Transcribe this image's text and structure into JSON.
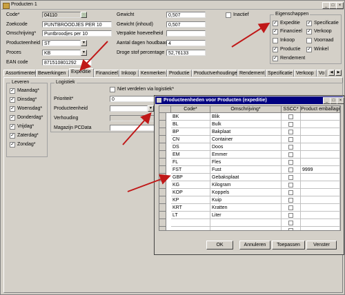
{
  "window": {
    "title": "Producten 1"
  },
  "top": {
    "code_label": "Code*",
    "code_value": "04110",
    "zoekcode_label": "Zoekcode",
    "zoekcode_value": "PUNTBROODJES PER 10",
    "omschrijving_label": "Omschrijving*",
    "omschrijving_value": "Puntbroodjes per 10",
    "producteenheid_label": "Producteenheid",
    "producteenheid_value": "ST",
    "proces_label": "Proces",
    "proces_value": "KB",
    "ean_label": "EAN code",
    "ean_value": "871510801292",
    "gewicht_label": "Gewicht",
    "gewicht_value": "0,507",
    "gewicht_inhoud_label": "Gewicht (inhoud)",
    "gewicht_inhoud_value": "0,507",
    "verpakte_label": "Verpakte hoeveelheid",
    "verpakte_value": "",
    "houdbaar_label": "Aantal dagen houdbaar",
    "houdbaar_value": "4",
    "droge_label": "Droge stof percentage",
    "droge_value": "52,76133",
    "inactief_label": "Inactief"
  },
  "eigenschappen": {
    "title": "Eigenschappen",
    "items": [
      {
        "label": "Expeditie",
        "checked": true
      },
      {
        "label": "Specificatie",
        "checked": true
      },
      {
        "label": "Financieel",
        "checked": true
      },
      {
        "label": "Verkoop",
        "checked": true
      },
      {
        "label": "Inkoop",
        "checked": false
      },
      {
        "label": "Voorraad",
        "checked": false
      },
      {
        "label": "Productie",
        "checked": true
      },
      {
        "label": "Winkel",
        "checked": true
      },
      {
        "label": "Rendement",
        "checked": true
      }
    ]
  },
  "tabs": [
    "Assortimenten",
    "Bewerkingen",
    "Expeditie",
    "Financieel",
    "Inkoop",
    "Kenmerken",
    "Productie",
    "Productverhoudingen",
    "Rendement",
    "Specificatie",
    "Verkoop",
    "Vo"
  ],
  "leveren": {
    "title": "Leveren",
    "days": [
      "Maandag*",
      "Dinsdag*",
      "Woensdag*",
      "Donderdag*",
      "Vrijdag*",
      "Zaterdag*",
      "Zondag*"
    ]
  },
  "logistiek": {
    "title": "Logistiek",
    "niet_verdelen": "Niet verdelen via logistiek*",
    "prioriteit_label": "Prioriteit*",
    "prioriteit_value": "0",
    "producteenheid_label": "Producteenheid",
    "verhouding_label": "Verhouding",
    "magazijn_label": "Magazijn PCData"
  },
  "dialog": {
    "title": "Producteenheden voor Producten (expeditie)",
    "columns": [
      "Code*",
      "Omschrijving*",
      "SSCC*",
      "Product emballage"
    ],
    "rows": [
      {
        "code": "BK",
        "omschrijving": "Blik",
        "emballage": ""
      },
      {
        "code": "BL",
        "omschrijving": "Bulk",
        "emballage": ""
      },
      {
        "code": "BP",
        "omschrijving": "Bakplaat",
        "emballage": ""
      },
      {
        "code": "CN",
        "omschrijving": "Container",
        "emballage": ""
      },
      {
        "code": "DS",
        "omschrijving": "Doos",
        "emballage": ""
      },
      {
        "code": "EM",
        "omschrijving": "Emmer",
        "emballage": ""
      },
      {
        "code": "FL",
        "omschrijving": "Fles",
        "emballage": ""
      },
      {
        "code": "FST",
        "omschrijving": "Fust",
        "emballage": "9999"
      },
      {
        "code": "GBP",
        "omschrijving": "Gebaksplaat",
        "emballage": ""
      },
      {
        "code": "KG",
        "omschrijving": "Kilogram",
        "emballage": ""
      },
      {
        "code": "KOP",
        "omschrijving": "Koppels",
        "emballage": ""
      },
      {
        "code": "KP",
        "omschrijving": "Kuip",
        "emballage": ""
      },
      {
        "code": "KRT",
        "omschrijving": "Kratten",
        "emballage": ""
      },
      {
        "code": "LT",
        "omschrijving": "Liter",
        "emballage": ""
      },
      {
        "code": "",
        "omschrijving": "",
        "emballage": ""
      },
      {
        "code": "",
        "omschrijving": "",
        "emballage": ""
      }
    ],
    "buttons": {
      "ok": "OK",
      "annuleren": "Annuleren",
      "toepassen": "Toepassen",
      "venster": "Venster"
    }
  },
  "colors": {
    "arrow": "#c01818",
    "dialog_title": "#000080",
    "face": "#d4d0c8"
  }
}
